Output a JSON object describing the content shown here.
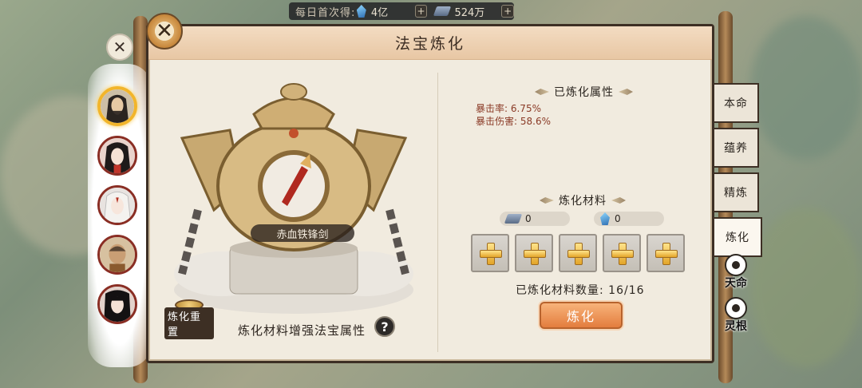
{
  "topbar": {
    "daily_first_label": "每日首次得:",
    "gem_amount": "4亿",
    "iron_amount": "524万",
    "plus_symbol": "+"
  },
  "panel": {
    "title": "法宝炼化",
    "close_symbol": "✕",
    "pin_symbol": "✕"
  },
  "weapon": {
    "name": "赤血铁锋剑"
  },
  "reset": {
    "label": "炼化重置"
  },
  "hint": {
    "text": "炼化材料增强法宝属性",
    "help_symbol": "?"
  },
  "refined_attrs": {
    "title": "已炼化属性",
    "items": [
      {
        "text": "暴击率:  6.75%"
      },
      {
        "text": "暴击伤害:  58.6%"
      }
    ]
  },
  "materials": {
    "title": "炼化材料",
    "iron_count": "0",
    "gem_count": "0",
    "slots": 5,
    "used_label": "已炼化材料数量:  16/16",
    "used": 16,
    "used_max": 16
  },
  "action": {
    "refine_label": "炼化"
  },
  "tabs": [
    {
      "label": "本命",
      "active": false
    },
    {
      "label": "蕴养",
      "active": false
    },
    {
      "label": "精炼",
      "active": false
    },
    {
      "label": "炼化",
      "active": true
    }
  ],
  "icon_tabs": [
    {
      "label": "天命",
      "icon": "fate-icon"
    },
    {
      "label": "灵根",
      "icon": "spirit-root-icon"
    }
  ],
  "avatars": [
    {
      "name": "avatar-long-hair-elder",
      "selected": true
    },
    {
      "name": "avatar-lady",
      "selected": false
    },
    {
      "name": "avatar-white-hair",
      "selected": false
    },
    {
      "name": "avatar-monk",
      "selected": false
    },
    {
      "name": "avatar-black-hair-girl",
      "selected": false
    }
  ],
  "colors": {
    "accent": "#e37d3e",
    "panel_bg": "#f1ebdf",
    "attr_text": "#8a3a26",
    "frame": "#3d2f24"
  }
}
